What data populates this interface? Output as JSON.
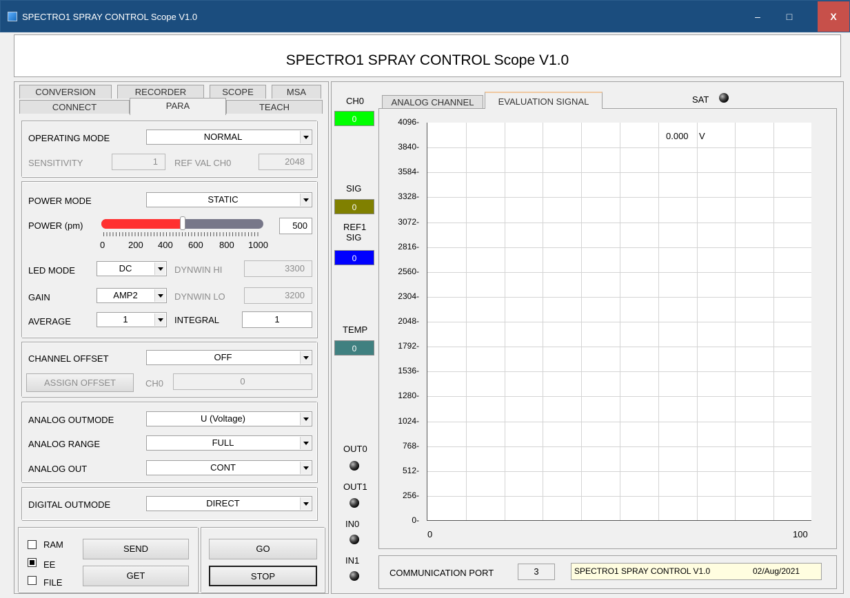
{
  "window": {
    "title": "SPECTRO1 SPRAY CONTROL Scope V1.0",
    "minimize": "–",
    "maximize": "□",
    "close": "X"
  },
  "banner": "SPECTRO1 SPRAY CONTROL Scope V1.0",
  "left_tabs": {
    "row1": [
      "CONVERSION",
      "RECORDER",
      "SCOPE",
      "MSA"
    ],
    "row2": [
      "CONNECT",
      "PARA",
      "TEACH"
    ],
    "active": "PARA"
  },
  "operating": {
    "mode_label": "OPERATING MODE",
    "mode_value": "NORMAL",
    "sensitivity_label": "SENSITIVITY",
    "sensitivity_value": "1",
    "refval_label": "REF VAL CH0",
    "refval_value": "2048"
  },
  "power": {
    "mode_label": "POWER MODE",
    "mode_value": "STATIC",
    "power_label": "POWER (pm)",
    "power_value": "500",
    "power_fraction": 0.5,
    "scale": [
      "0",
      "200",
      "400",
      "600",
      "800",
      "1000"
    ],
    "led_mode_label": "LED MODE",
    "led_mode_value": "DC",
    "dynwin_hi_label": "DYNWIN HI",
    "dynwin_hi_value": "3300",
    "gain_label": "GAIN",
    "gain_value": "AMP2",
    "dynwin_lo_label": "DYNWIN LO",
    "dynwin_lo_value": "3200",
    "average_label": "AVERAGE",
    "average_value": "1",
    "integral_label": "INTEGRAL",
    "integral_value": "1"
  },
  "offset": {
    "label": "CHANNEL OFFSET",
    "value": "OFF",
    "assign_button": "ASSIGN OFFSET",
    "ch0_label": "CH0",
    "ch0_value": "0"
  },
  "analog": {
    "outmode_label": "ANALOG OUTMODE",
    "outmode_value": "U (Voltage)",
    "range_label": "ANALOG RANGE",
    "range_value": "FULL",
    "out_label": "ANALOG OUT",
    "out_value": "CONT"
  },
  "digital": {
    "outmode_label": "DIGITAL OUTMODE",
    "outmode_value": "DIRECT"
  },
  "bottom": {
    "ram_label": "RAM",
    "ee_label": "EE",
    "file_label": "FILE",
    "send": "SEND",
    "get": "GET",
    "go": "GO",
    "stop": "STOP"
  },
  "indicators": {
    "ch0_label": "CH0",
    "ch0_value": "0",
    "ch0_color": "#00ff00",
    "sig_label": "SIG",
    "sig_value": "0",
    "sig_color": "#808000",
    "ref1_label_1": "REF1",
    "ref1_label_2": "SIG",
    "ref1_value": "0",
    "ref1_color": "#0000ff",
    "temp_label": "TEMP",
    "temp_value": "0",
    "temp_color": "#408080",
    "out0_label": "OUT0",
    "out1_label": "OUT1",
    "in0_label": "IN0",
    "in1_label": "IN1"
  },
  "right_tabs": {
    "tabs": [
      "ANALOG CHANNEL",
      "EVALUATION SIGNAL"
    ],
    "active": "EVALUATION SIGNAL",
    "sat_label": "SAT"
  },
  "chart": {
    "readout_value": "0.000",
    "readout_unit": "V",
    "y_ticks": [
      "4096",
      "3840",
      "3584",
      "3328",
      "3072",
      "2816",
      "2560",
      "2304",
      "2048",
      "1792",
      "1536",
      "1280",
      "1024",
      "768",
      "512",
      "256",
      "0"
    ],
    "x_min": "0",
    "x_max": "100"
  },
  "comm": {
    "label": "COMMUNICATION PORT",
    "port": "3",
    "status": "SPECTRO1 SPRAY CONTROL V1.0",
    "date": "02/Aug/2021"
  }
}
